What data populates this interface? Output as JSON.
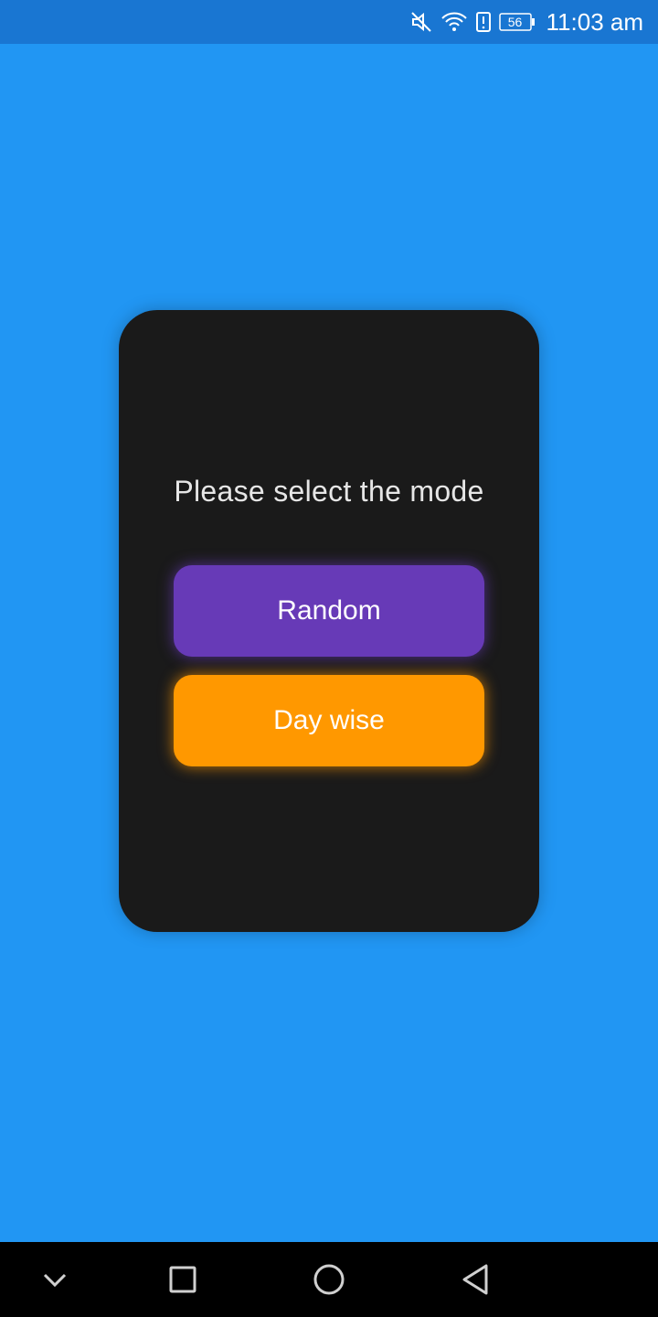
{
  "status_bar": {
    "time": "11:03 am",
    "battery_level": "56",
    "icons": [
      "mute-icon",
      "wifi-icon",
      "alert-icon",
      "battery-icon"
    ]
  },
  "dialog": {
    "title": "Please select the mode",
    "buttons": [
      {
        "label": "Random",
        "color": "#673AB7"
      },
      {
        "label": "Day wise",
        "color": "#FF9800"
      }
    ]
  },
  "nav_bar": {
    "buttons": [
      "collapse-icon",
      "recents-icon",
      "home-icon",
      "back-icon"
    ]
  },
  "colors": {
    "background": "#2196F3",
    "status_bar": "#1976D2",
    "card": "#1A1A1A"
  }
}
